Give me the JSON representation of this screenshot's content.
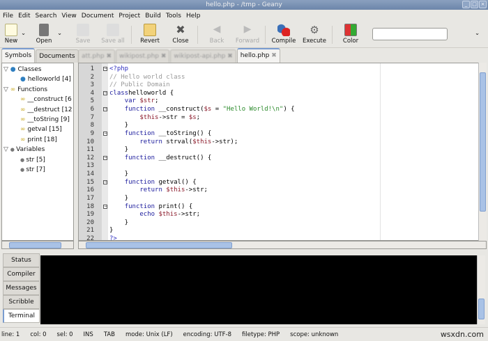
{
  "window": {
    "title": "hello.php - /tmp - Geany"
  },
  "menu": [
    "File",
    "Edit",
    "Search",
    "View",
    "Document",
    "Project",
    "Build",
    "Tools",
    "Help"
  ],
  "toolbar": {
    "new": "New",
    "open": "Open",
    "save": "Save",
    "save_all": "Save all",
    "revert": "Revert",
    "close": "Close",
    "back": "Back",
    "forward": "Forward",
    "compile": "Compile",
    "execute": "Execute",
    "color": "Color",
    "search_value": ""
  },
  "sidebar": {
    "tabs": [
      "Symbols",
      "Documents"
    ],
    "tree": [
      {
        "label": "Classes",
        "level": 0,
        "icon": "class-icon"
      },
      {
        "label": "helloworld [4]",
        "level": 1,
        "icon": "class-icon"
      },
      {
        "label": "Functions",
        "level": 0,
        "icon": "function-icon"
      },
      {
        "label": "__construct [6",
        "level": 1,
        "icon": "function-icon"
      },
      {
        "label": "__destruct [12",
        "level": 1,
        "icon": "function-icon"
      },
      {
        "label": "__toString [9]",
        "level": 1,
        "icon": "function-icon"
      },
      {
        "label": "getval [15]",
        "level": 1,
        "icon": "function-icon"
      },
      {
        "label": "print [18]",
        "level": 1,
        "icon": "function-icon"
      },
      {
        "label": "Variables",
        "level": 0,
        "icon": "variable-icon"
      },
      {
        "label": "str [5]",
        "level": 1,
        "icon": "variable-icon"
      },
      {
        "label": "str [7]",
        "level": 1,
        "icon": "variable-icon"
      }
    ]
  },
  "editor": {
    "tabs": [
      {
        "label": "att.php",
        "blur": true
      },
      {
        "label": "wikipost.php",
        "blur": true
      },
      {
        "label": "wikipost-api.php",
        "blur": true
      },
      {
        "label": "hello.php",
        "active": true
      }
    ],
    "lines": [
      [
        [
          "t",
          "<?php"
        ]
      ],
      [
        [
          "c",
          "// Hello world class"
        ]
      ],
      [
        [
          "c",
          "// Public Domain"
        ]
      ],
      [
        [
          "k",
          "class"
        ],
        [
          "",
          "helloworld {"
        ]
      ],
      [
        [
          "",
          "    "
        ],
        [
          "k",
          "var"
        ],
        [
          "",
          ""
        ],
        [
          "v",
          " $str"
        ],
        [
          "",
          ";"
        ]
      ],
      [
        [
          "",
          "    "
        ],
        [
          "k",
          "function"
        ],
        [
          "",
          " __construct("
        ],
        [
          "v",
          "$s"
        ],
        [
          "",
          " = "
        ],
        [
          "s",
          "\"Hello World!\\n\""
        ],
        [
          "",
          ") {"
        ]
      ],
      [
        [
          "",
          "        "
        ],
        [
          "v",
          "$this"
        ],
        [
          "",
          "->str = "
        ],
        [
          "v",
          "$s"
        ],
        [
          "",
          ";"
        ]
      ],
      [
        [
          "",
          "    }"
        ]
      ],
      [
        [
          "",
          "    "
        ],
        [
          "k",
          "function"
        ],
        [
          "",
          " __toString() {"
        ]
      ],
      [
        [
          "",
          "        "
        ],
        [
          "k",
          "return"
        ],
        [
          "",
          " strval("
        ],
        [
          "v",
          "$this"
        ],
        [
          "",
          "->str);"
        ]
      ],
      [
        [
          "",
          "    }"
        ]
      ],
      [
        [
          "",
          "    "
        ],
        [
          "k",
          "function"
        ],
        [
          "",
          " __destruct() {"
        ]
      ],
      [
        [
          "",
          ""
        ]
      ],
      [
        [
          "",
          "    }"
        ]
      ],
      [
        [
          "",
          "    "
        ],
        [
          "k",
          "function"
        ],
        [
          "",
          " getval() {"
        ]
      ],
      [
        [
          "",
          "        "
        ],
        [
          "k",
          "return"
        ],
        [
          "v",
          " $this"
        ],
        [
          "",
          "->str;"
        ]
      ],
      [
        [
          "",
          "    }"
        ]
      ],
      [
        [
          "",
          "    "
        ],
        [
          "k",
          "function"
        ],
        [
          "",
          " print() {"
        ]
      ],
      [
        [
          "",
          "        "
        ],
        [
          "k",
          "echo"
        ],
        [
          "v",
          " $this"
        ],
        [
          "",
          "->str;"
        ]
      ],
      [
        [
          "",
          "    }"
        ]
      ],
      [
        [
          "",
          "}"
        ]
      ],
      [
        [
          "t",
          "?>"
        ]
      ]
    ],
    "fold_lines": [
      1,
      4,
      6,
      9,
      12,
      15,
      18
    ]
  },
  "bottom_panel": {
    "tabs": [
      "Status",
      "Compiler",
      "Messages",
      "Scribble",
      "Terminal"
    ],
    "active": "Terminal"
  },
  "statusbar": [
    "line: 1",
    "col: 0",
    "sel: 0",
    "INS",
    "TAB",
    "mode: Unix (LF)",
    "encoding: UTF-8",
    "filetype: PHP",
    "scope: unknown"
  ],
  "watermark": "wsxdn.com"
}
